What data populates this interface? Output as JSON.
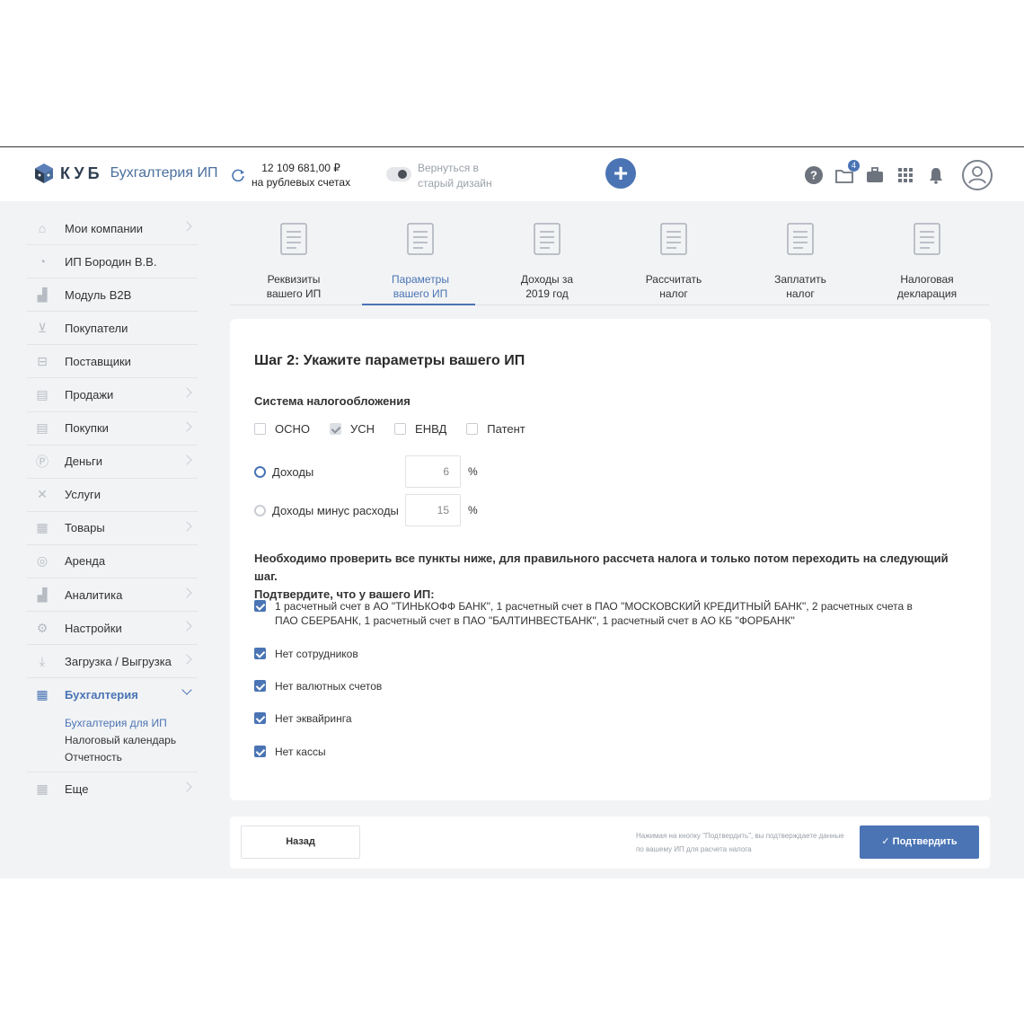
{
  "header": {
    "logo_text": "КУБ",
    "logo_sub": "Бухгалтерия ИП",
    "balance_amount": "12 109 681,00 ₽",
    "balance_caption": "на рублевых счетах",
    "old_design_line1": "Вернуться в",
    "old_design_line2": "старый дизайн",
    "plus_label": "+",
    "help_glyph": "?",
    "docs_badge": "4"
  },
  "sidebar": {
    "items": [
      {
        "label": "Мои компании",
        "icon": "home-icon"
      },
      {
        "label": "ИП Бородин В.В.",
        "icon": "company-icon"
      },
      {
        "label": "Модуль B2B",
        "icon": "chart-icon"
      },
      {
        "label": "Покупатели",
        "icon": "cart-icon"
      },
      {
        "label": "Поставщики",
        "icon": "supplier-icon"
      },
      {
        "label": "Продажи",
        "icon": "sales-icon"
      },
      {
        "label": "Покупки",
        "icon": "purchases-icon"
      },
      {
        "label": "Деньги",
        "icon": "money-icon"
      },
      {
        "label": "Услуги",
        "icon": "tools-icon"
      },
      {
        "label": "Товары",
        "icon": "goods-icon"
      },
      {
        "label": "Аренда",
        "icon": "rent-icon"
      },
      {
        "label": "Аналитика",
        "icon": "analytics-icon"
      },
      {
        "label": "Настройки",
        "icon": "gear-icon"
      },
      {
        "label": "Загрузка / Выгрузка",
        "icon": "upload-icon"
      }
    ],
    "accounting": {
      "label": "Бухгалтерия",
      "icon": "calculator-icon"
    },
    "sub_items": [
      "Бухгалтерия для ИП",
      "Налоговый календарь",
      "Отчетность"
    ],
    "more": {
      "label": "Еще",
      "icon": "grid-icon"
    }
  },
  "steps": [
    {
      "line1": "Реквизиты",
      "line2": "вашего ИП"
    },
    {
      "line1": "Параметры",
      "line2": "вашего ИП"
    },
    {
      "line1": "Доходы за",
      "line2": "2019 год"
    },
    {
      "line1": "Рассчитать",
      "line2": "налог"
    },
    {
      "line1": "Заплатить",
      "line2": "налог"
    },
    {
      "line1": "Налоговая",
      "line2": "декларация"
    }
  ],
  "form": {
    "title": "Шаг 2: Укажите параметры вашего ИП",
    "tax_system_title": "Система налогообложения",
    "tax_systems": [
      {
        "label": "ОСНО",
        "checked": false
      },
      {
        "label": "УСН",
        "checked": true
      },
      {
        "label": "ЕНВД",
        "checked": false
      },
      {
        "label": "Патент",
        "checked": false
      }
    ],
    "rate_income_label": "Доходы",
    "rate_income_value": "6",
    "rate_income_minus_label": "Доходы минус расходы",
    "rate_income_minus_value": "15",
    "pct": "%",
    "notice_line1": "Необходимо проверить все пункты ниже, для правильного рассчета налога и только потом переходить на следующий шаг.",
    "notice_line2": "Подтвердите, что у вашего ИП:",
    "confirmations": [
      "1 расчетный счет в АО \"ТИНЬКОФФ БАНК\", 1 расчетный счет в ПАО \"МОСКОВСКИЙ КРЕДИТНЫЙ БАНК\", 2 расчетных счета в ПАО СБЕРБАНК, 1 расчетный счет в ПАО \"БАЛТИНВЕСТБАНК\", 1 расчетный счет в АО КБ \"ФОРБАНК\"",
      "Нет сотрудников",
      "Нет валютных счетов",
      "Нет эквайринга",
      "Нет кассы"
    ]
  },
  "footer": {
    "back_label": "Назад",
    "footnote": "Нажимая на кнопку \"Подтвердить\", вы подтверждаете данные по вашему ИП для расчета налога",
    "confirm_label": "Подтвердить"
  },
  "colors": {
    "accent": "#4a74b4",
    "background": "#f2f3f5"
  }
}
